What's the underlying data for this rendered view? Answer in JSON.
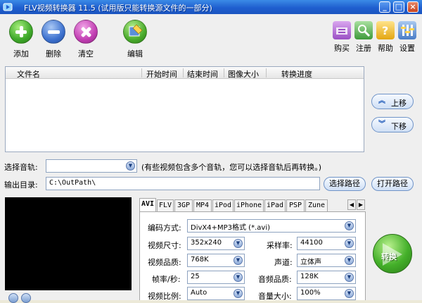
{
  "window": {
    "title": "FLV视频转换器 11.5 (试用版只能转换源文件的一部分)",
    "title_color": "#1f5fcf"
  },
  "toolbar": {
    "add": "添加",
    "delete": "删除",
    "clear": "清空",
    "edit": "编辑",
    "buy": "购买",
    "register": "注册",
    "help": "帮助",
    "settings": "设置"
  },
  "file_list": {
    "columns": [
      "文件名",
      "开始时间",
      "结束时间",
      "图像大小",
      "转换进度"
    ],
    "rows": []
  },
  "side_buttons": {
    "move_up": "上移",
    "move_down": "下移"
  },
  "audio_track": {
    "label": "选择音轨:",
    "value": "",
    "hint": "(有些视频包含多个音轨，您可以选择音轨后再转换。)"
  },
  "output": {
    "label": "输出目录:",
    "path": "C:\\OutPath\\",
    "choose_path": "选择路径",
    "open_path": "打开路径"
  },
  "format_tabs": {
    "tabs": [
      "AVI",
      "FLV",
      "3GP",
      "MP4",
      "iPod",
      "iPhone",
      "iPad",
      "PSP",
      "Zune"
    ],
    "active": "AVI"
  },
  "settings": {
    "encoding_label": "编码方式:",
    "encoding_value": "DivX4+MP3格式 (*.avi)",
    "video_size_label": "视频尺寸:",
    "video_size_value": "352x240",
    "sample_rate_label": "采样率:",
    "sample_rate_value": "44100",
    "video_quality_label": "视频品质:",
    "video_quality_value": "768K",
    "channel_label": "声道:",
    "channel_value": "立体声",
    "fps_label": "帧率/秒:",
    "fps_value": "25",
    "audio_quality_label": "音频品质:",
    "audio_quality_value": "128K",
    "aspect_label": "视频比例:",
    "aspect_value": "Auto",
    "volume_label": "音量大小:",
    "volume_value": "100%"
  },
  "convert_button": {
    "label": "转换",
    "color": "#44b02a"
  }
}
